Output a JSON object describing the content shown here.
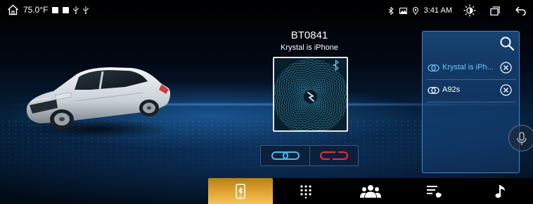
{
  "status_bar": {
    "temperature": "75.0°F",
    "time": "3:41 AM"
  },
  "device": {
    "name": "BT0841",
    "connected_phone": "Krystal is iPhone"
  },
  "paired_devices": [
    {
      "label": "Krystal is iPh...",
      "active": true
    },
    {
      "label": "A92s",
      "active": false
    }
  ],
  "colors": {
    "accent_blue": "#6ec6ff",
    "disconnect_red": "#e8323c",
    "active_tab": "#e2a634"
  },
  "icons": {
    "home": "home-icon",
    "search": "search-icon",
    "brightness": "brightness-icon",
    "multiwindow": "multiwindow-icon",
    "back": "back-icon",
    "mic": "microphone-icon"
  },
  "nav_tabs": [
    {
      "name": "phone-device",
      "active": true
    },
    {
      "name": "dialpad",
      "active": false
    },
    {
      "name": "contacts",
      "active": false
    },
    {
      "name": "call-log",
      "active": false
    },
    {
      "name": "music",
      "active": false
    }
  ]
}
